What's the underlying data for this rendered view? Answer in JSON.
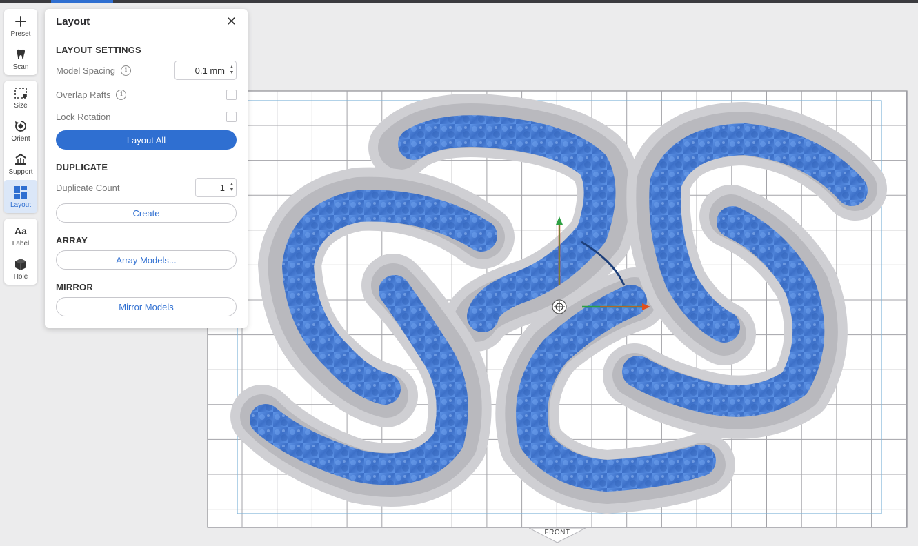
{
  "toolbar": {
    "groups": [
      [
        {
          "label": "Preset",
          "icon": "plus-icon"
        },
        {
          "label": "Scan",
          "icon": "tooth-icon"
        }
      ],
      [
        {
          "label": "Size",
          "icon": "resize-box-icon"
        },
        {
          "label": "Orient",
          "icon": "orient-icon"
        },
        {
          "label": "Support",
          "icon": "support-icon"
        },
        {
          "label": "Layout",
          "icon": "layout-grid-icon",
          "active": true
        }
      ],
      [
        {
          "label": "Label",
          "icon": "text-aa-icon"
        },
        {
          "label": "Hole",
          "icon": "cube-icon"
        }
      ]
    ]
  },
  "panel": {
    "title": "Layout",
    "layout_settings": {
      "heading": "LAYOUT SETTINGS",
      "model_spacing_label": "Model Spacing",
      "model_spacing_value": "0.1 mm",
      "overlap_rafts_label": "Overlap Rafts",
      "overlap_rafts_checked": false,
      "lock_rotation_label": "Lock Rotation",
      "lock_rotation_checked": false,
      "layout_all_button": "Layout All"
    },
    "duplicate": {
      "heading": "DUPLICATE",
      "count_label": "Duplicate Count",
      "count_value": "1",
      "create_button": "Create"
    },
    "array": {
      "heading": "ARRAY",
      "array_button": "Array Models..."
    },
    "mirror": {
      "heading": "MIRROR",
      "mirror_button": "Mirror Models"
    }
  },
  "viewport": {
    "front_label": "FRONT",
    "model_count": 6
  },
  "colors": {
    "accent": "#2f6fd1",
    "model_blue": "#4a7fd6",
    "raft_gray": "#c4c4c8",
    "grid_line": "#9a9aa0",
    "build_boundary": "#7fb3d9",
    "axis_x": "#e0501e",
    "axis_y": "#2ea043",
    "rotate_arc": "#1d3f7a"
  }
}
